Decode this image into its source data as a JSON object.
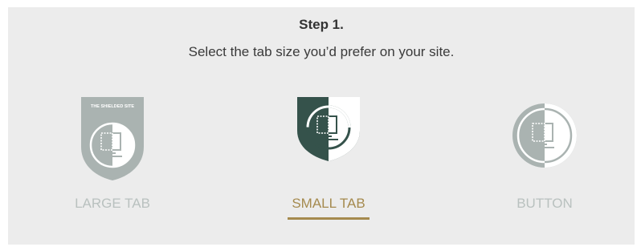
{
  "step": {
    "title": "Step 1.",
    "subtitle": "Select the tab size you’d prefer on your site."
  },
  "options": [
    {
      "label": "LARGE TAB",
      "badge_text": "THE SHIELDED SITE",
      "icon": "large-shield-icon",
      "selected": false
    },
    {
      "label": "SMALL TAB",
      "icon": "small-shield-icon",
      "selected": true
    },
    {
      "label": "BUTTON",
      "icon": "circle-button-icon",
      "selected": false
    }
  ],
  "colors": {
    "panel_background": "#ececec",
    "selected_accent": "#a58a4e",
    "selected_icon": "#35524b",
    "inactive_icon": "#aab3b1",
    "inactive_label": "#b9c1bf"
  }
}
